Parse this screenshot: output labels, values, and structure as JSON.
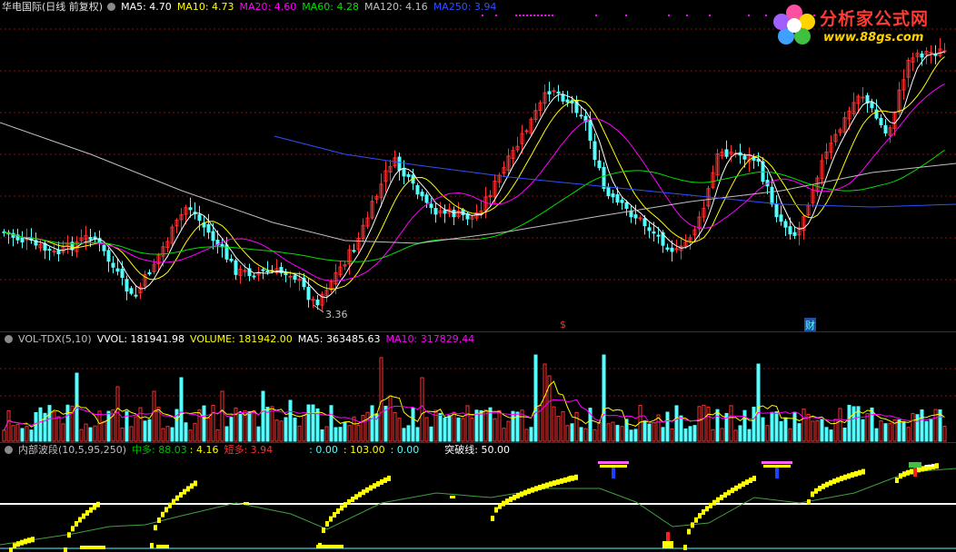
{
  "header": {
    "stock": "华电国际(日线 前复权)",
    "ma5": "MA5: 4.70",
    "ma10": "MA10: 4.73",
    "ma20": "MA20: 4.60",
    "ma60": "MA60: 4.28",
    "ma120": "MA120: 4.16",
    "ma250": "MA250: 3.94"
  },
  "logo": {
    "title": "分析家公式网",
    "url": "www.88gs.com"
  },
  "price_panel": {
    "low_label": "3.36",
    "marker_dividend": "$",
    "marker_finance": "财"
  },
  "volume_panel": {
    "name": "VOL-TDX(5,10)",
    "vvol": "VVOL: 181941.98",
    "volume": "VOLUME: 181942.00",
    "ma5": "MA5: 363485.63",
    "ma10": "MA10: 317829.44"
  },
  "indicator_panel": {
    "name": "内部波段(10,5,95,250)",
    "mid": "中多: 88.03",
    "val": ": 4.16",
    "short": "短多: 3.94",
    "zero": ": 0.00",
    "hundred": ": 103.00",
    "zero2": ": 0.00",
    "breakout": "突破线: 50.00"
  },
  "colors": {
    "ma5": "#ffffff",
    "ma10": "#ffff00",
    "ma20": "#ff00ff",
    "ma60": "#00e000",
    "ma120": "#c0c0c0",
    "ma250": "#3050ff",
    "up": "#ff3030",
    "down": "#54ffff",
    "grid": "#8a1010"
  },
  "chart_data": [
    {
      "type": "candlestick",
      "title": "华电国际(日线 前复权)",
      "series": [
        {
          "name": "MA5",
          "values": [
            4.7
          ]
        },
        {
          "name": "MA10",
          "values": [
            4.73
          ]
        },
        {
          "name": "MA20",
          "values": [
            4.6
          ]
        },
        {
          "name": "MA60",
          "values": [
            4.28
          ]
        },
        {
          "name": "MA120",
          "values": [
            4.16
          ]
        },
        {
          "name": "MA250",
          "values": [
            3.94
          ]
        }
      ],
      "annotations": [
        "3.36"
      ],
      "grid": true
    },
    {
      "type": "bar",
      "title": "VOL-TDX(5,10)",
      "series": [
        {
          "name": "VVOL",
          "values": [
            181941.98
          ]
        },
        {
          "name": "VOLUME",
          "values": [
            181942.0
          ]
        },
        {
          "name": "MA5",
          "values": [
            363485.63
          ]
        },
        {
          "name": "MA10",
          "values": [
            317829.44
          ]
        }
      ]
    },
    {
      "type": "line",
      "title": "内部波段(10,5,95,250)",
      "series": [
        {
          "name": "中多",
          "values": [
            88.03
          ]
        },
        {
          "name": "短多",
          "values": [
            3.94
          ]
        },
        {
          "name": "突破线",
          "values": [
            50.0
          ]
        }
      ]
    }
  ]
}
